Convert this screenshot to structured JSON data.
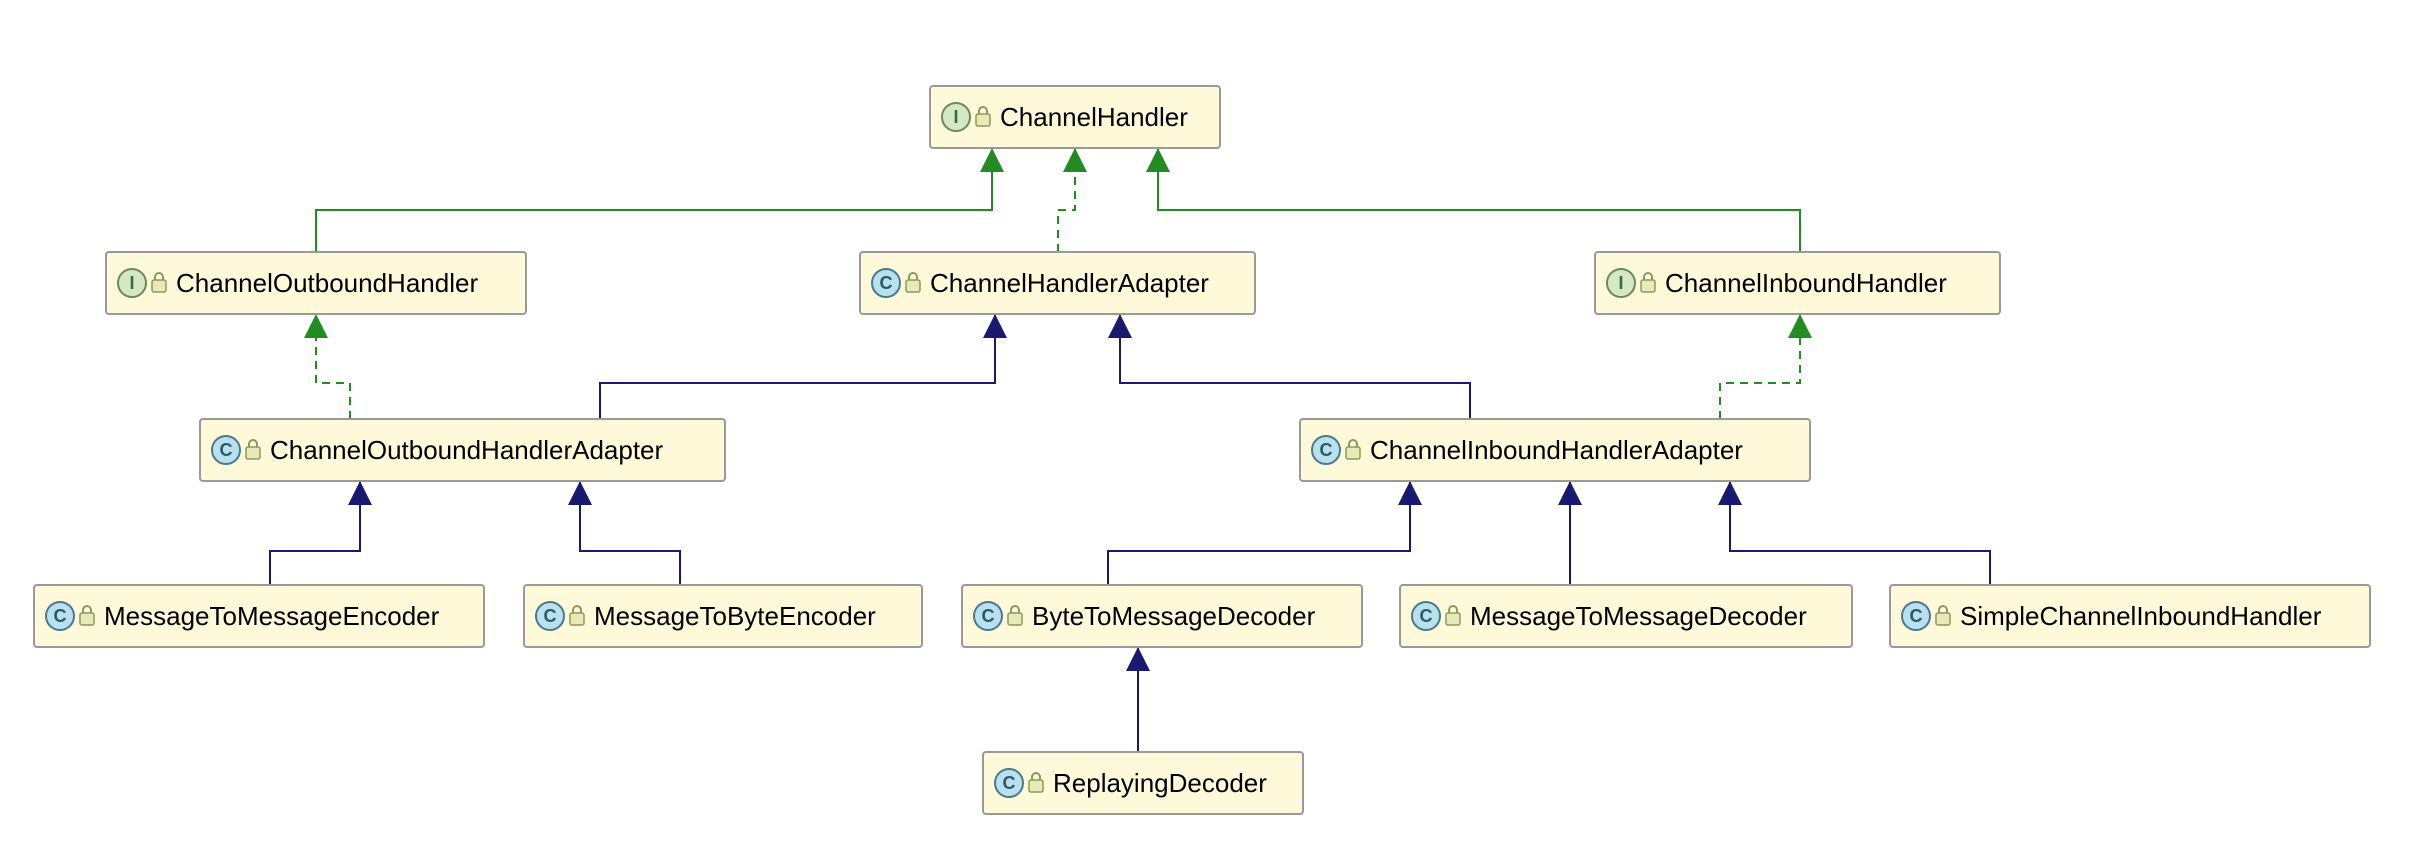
{
  "nodes": {
    "channelHandler": {
      "label": "ChannelHandler",
      "type": "I"
    },
    "channelOutboundHandler": {
      "label": "ChannelOutboundHandler",
      "type": "I"
    },
    "channelHandlerAdapter": {
      "label": "ChannelHandlerAdapter",
      "type": "C"
    },
    "channelInboundHandler": {
      "label": "ChannelInboundHandler",
      "type": "I"
    },
    "channelOutboundHandlerAdapter": {
      "label": "ChannelOutboundHandlerAdapter",
      "type": "C"
    },
    "channelInboundHandlerAdapter": {
      "label": "ChannelInboundHandlerAdapter",
      "type": "C"
    },
    "messageToMessageEncoder": {
      "label": "MessageToMessageEncoder",
      "type": "C"
    },
    "messageToByteEncoder": {
      "label": "MessageToByteEncoder",
      "type": "C"
    },
    "byteToMessageDecoder": {
      "label": "ByteToMessageDecoder",
      "type": "C"
    },
    "messageToMessageDecoder": {
      "label": "MessageToMessageDecoder",
      "type": "C"
    },
    "simpleChannelInboundHandler": {
      "label": "SimpleChannelInboundHandler",
      "type": "C"
    },
    "replayingDecoder": {
      "label": "ReplayingDecoder",
      "type": "C"
    }
  },
  "edges": [
    {
      "from": "channelOutboundHandler",
      "to": "channelHandler",
      "style": "solidGreen"
    },
    {
      "from": "channelHandlerAdapter",
      "to": "channelHandler",
      "style": "dashedGreen"
    },
    {
      "from": "channelInboundHandler",
      "to": "channelHandler",
      "style": "solidGreen"
    },
    {
      "from": "channelOutboundHandlerAdapter",
      "to": "channelOutboundHandler",
      "style": "dashedGreen"
    },
    {
      "from": "channelOutboundHandlerAdapter",
      "to": "channelHandlerAdapter",
      "style": "solidBlue"
    },
    {
      "from": "channelInboundHandlerAdapter",
      "to": "channelHandlerAdapter",
      "style": "solidBlue"
    },
    {
      "from": "channelInboundHandlerAdapter",
      "to": "channelInboundHandler",
      "style": "dashedGreen"
    },
    {
      "from": "messageToMessageEncoder",
      "to": "channelOutboundHandlerAdapter",
      "style": "solidBlue"
    },
    {
      "from": "messageToByteEncoder",
      "to": "channelOutboundHandlerAdapter",
      "style": "solidBlue"
    },
    {
      "from": "byteToMessageDecoder",
      "to": "channelInboundHandlerAdapter",
      "style": "solidBlue"
    },
    {
      "from": "messageToMessageDecoder",
      "to": "channelInboundHandlerAdapter",
      "style": "solidBlue"
    },
    {
      "from": "simpleChannelInboundHandler",
      "to": "channelInboundHandlerAdapter",
      "style": "solidBlue"
    },
    {
      "from": "replayingDecoder",
      "to": "byteToMessageDecoder",
      "style": "solidBlue"
    }
  ]
}
